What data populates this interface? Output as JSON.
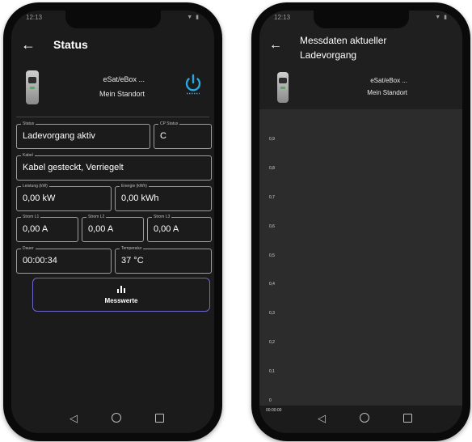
{
  "status_screen": {
    "statusbar": {
      "time": "12:13",
      "icons": "▼ ▮"
    },
    "title": "Status",
    "device": {
      "name": "eSat/eBox ...",
      "location": "Mein Standort"
    },
    "fields": {
      "status": {
        "label": "Status",
        "value": "Ladevorgang aktiv"
      },
      "cp_status": {
        "label": "CP Status",
        "value": "C"
      },
      "kabel": {
        "label": "Kabel",
        "value": "Kabel gesteckt, Verriegelt"
      },
      "leistung": {
        "label": "Leistung (kW)",
        "value": "0,00 kW"
      },
      "energie": {
        "label": "Energie (kWh)",
        "value": "0,00 kWh"
      },
      "strom_l1": {
        "label": "Strom L1",
        "value": "0,00 A"
      },
      "strom_l2": {
        "label": "Strom L2",
        "value": "0,00 A"
      },
      "strom_l3": {
        "label": "Strom L3",
        "value": "0,00 A"
      },
      "dauer": {
        "label": "Dauer",
        "value": "00:00:34"
      },
      "temperatur": {
        "label": "Temperatur",
        "value": "37 °C"
      }
    },
    "messwerte_button": "Messwerte",
    "accent_color": "#29a8e0"
  },
  "measurement_screen": {
    "statusbar": {
      "time": "12:13",
      "icons": "▼ ▮"
    },
    "title": "Messdaten aktueller Ladevorgang",
    "device": {
      "name": "eSat/eBox ...",
      "location": "Mein Standort"
    }
  },
  "chart_data": {
    "type": "line",
    "title": "",
    "xlabel": "",
    "ylabel": "",
    "y_ticks": [
      "0,9",
      "0,8",
      "0,7",
      "0,6",
      "0,5",
      "0,4",
      "0,3",
      "0,2",
      "0,1",
      "0"
    ],
    "x_ticks": [
      "00:00:00"
    ],
    "ylim": [
      0,
      0.9
    ],
    "series": []
  }
}
